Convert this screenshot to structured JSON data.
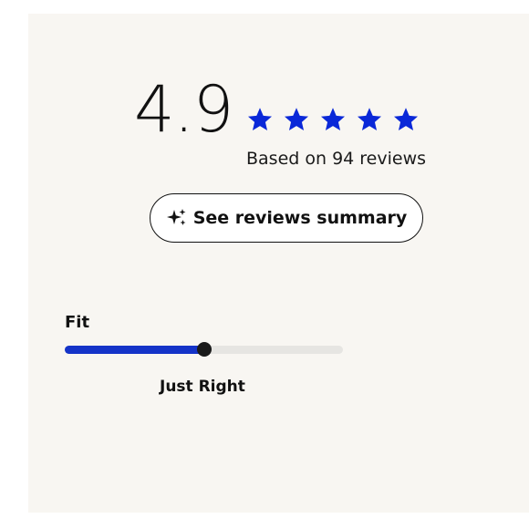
{
  "rating": {
    "score": "4.9",
    "stars": 5,
    "star_color": "#0a28d8",
    "reviews_text": "Based on 94 reviews"
  },
  "summary_button": {
    "icon": "sparkle-icon",
    "label": "See reviews summary"
  },
  "fit": {
    "label": "Fit",
    "value_label": "Just Right",
    "level_fraction": 0.5,
    "fill_color": "#1433c8"
  }
}
